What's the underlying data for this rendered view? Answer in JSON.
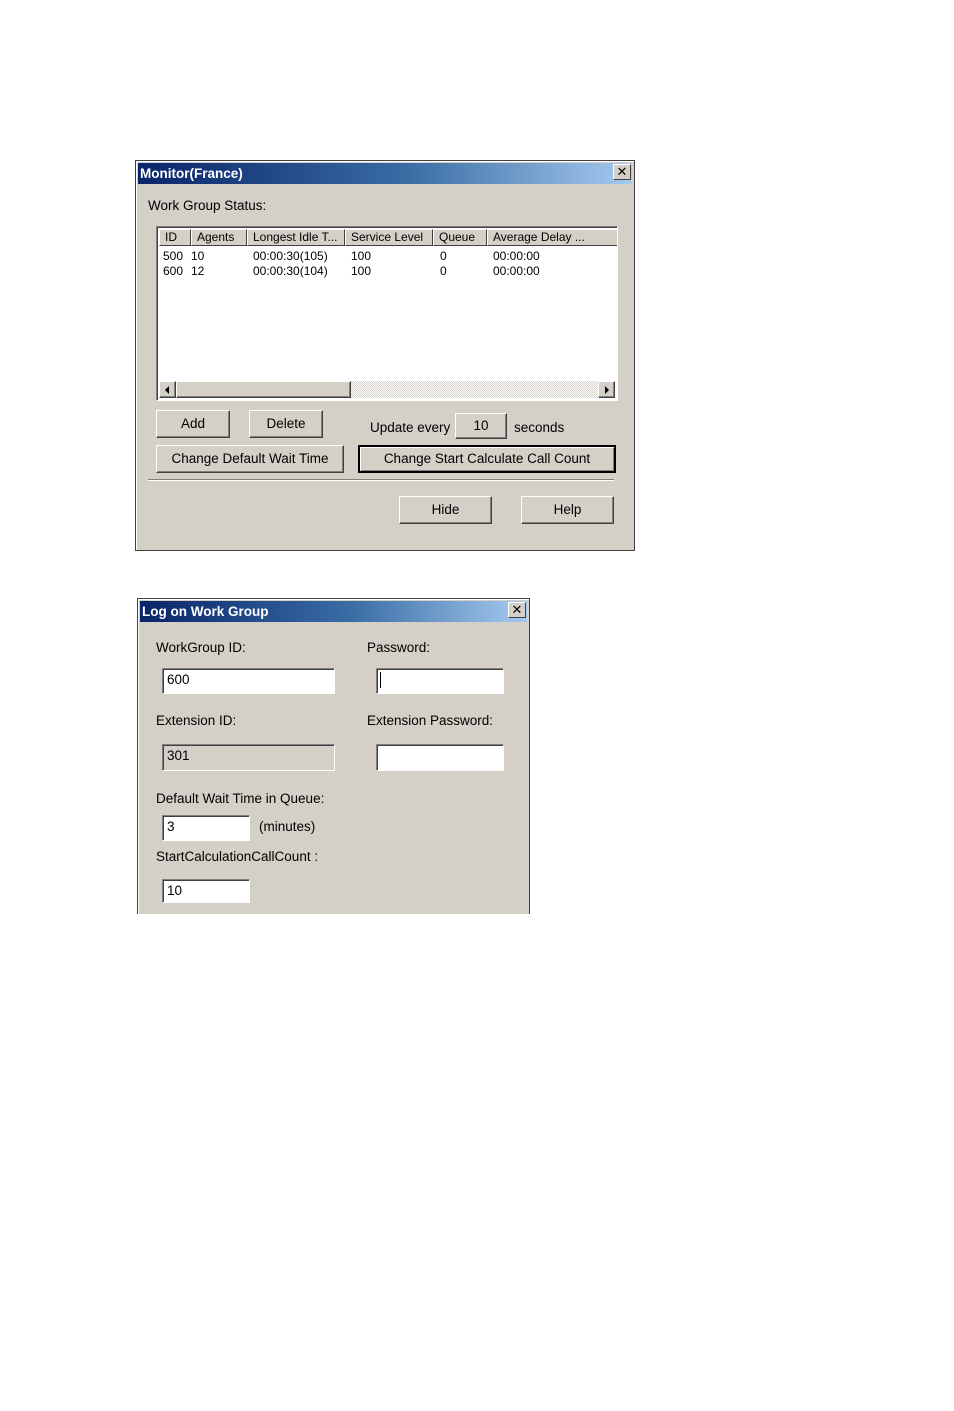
{
  "monitor": {
    "title": "Monitor(France)",
    "close_glyph": "✕",
    "section_label": "Work Group Status:",
    "columns": [
      "ID",
      "Agents",
      "Longest Idle T...",
      "Service Level",
      "Queue",
      "Average Delay ..."
    ],
    "rows": [
      {
        "id": "500",
        "agents": "10",
        "longest_idle": "00:00:30(105)",
        "service_level": "100",
        "queue": "0",
        "average_delay": "00:00:00"
      },
      {
        "id": "600",
        "agents": "12",
        "longest_idle": "00:00:30(104)",
        "service_level": "100",
        "queue": "0",
        "average_delay": "00:00:00"
      }
    ],
    "add_label": "Add",
    "delete_label": "Delete",
    "update_every_label": "Update every",
    "update_every_value": "10",
    "seconds_label": "seconds",
    "change_wait_label": "Change Default Wait Time",
    "change_start_label": "Change Start Calculate Call Count",
    "hide_label": "Hide",
    "help_label": "Help"
  },
  "logon": {
    "title": "Log on Work Group",
    "close_glyph": "✕",
    "workgroup_id_label": "WorkGroup ID:",
    "workgroup_id_value": "600",
    "password_label": "Password:",
    "password_value": "",
    "extension_id_label": "Extension ID:",
    "extension_id_value": "301",
    "extension_password_label": "Extension Password:",
    "extension_password_value": "",
    "wait_time_label": "Default Wait Time in Queue:",
    "wait_time_value": "3",
    "minutes_label": "(minutes)",
    "start_calc_label": "StartCalculationCallCount :",
    "start_calc_value": "10"
  }
}
